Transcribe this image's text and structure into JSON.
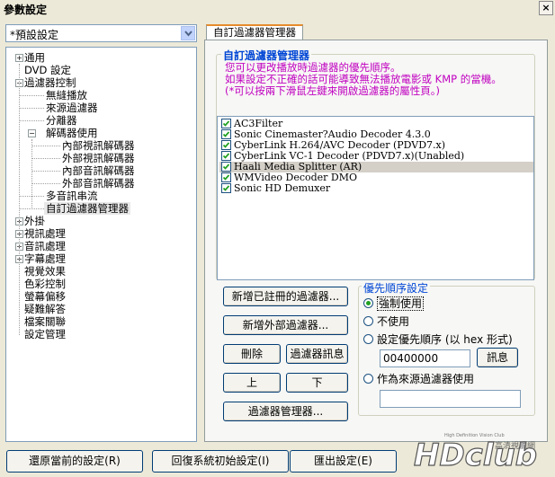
{
  "window": {
    "title": "參數設定",
    "close_label": "×"
  },
  "profile": {
    "selected": "*預設設定"
  },
  "tree": [
    {
      "label": "通用",
      "level": 0,
      "expander": "+"
    },
    {
      "label": "DVD 設定",
      "level": 0,
      "expander": ""
    },
    {
      "label": "過濾器控制",
      "level": 0,
      "expander": "-"
    },
    {
      "label": "無縫播放",
      "level": 1,
      "expander": ""
    },
    {
      "label": "來源過濾器",
      "level": 1,
      "expander": ""
    },
    {
      "label": "分離器",
      "level": 1,
      "expander": ""
    },
    {
      "label": "解碼器使用",
      "level": 1,
      "expander": "-"
    },
    {
      "label": "內部視訊解碼器",
      "level": 2,
      "expander": ""
    },
    {
      "label": "外部視訊解碼器",
      "level": 2,
      "expander": ""
    },
    {
      "label": "內部音訊解碼器",
      "level": 2,
      "expander": ""
    },
    {
      "label": "外部音訊解碼器",
      "level": 2,
      "expander": ""
    },
    {
      "label": "多音訊串流",
      "level": 1,
      "expander": ""
    },
    {
      "label": "自訂過濾器管理器",
      "level": 1,
      "expander": "",
      "selected": true
    },
    {
      "label": "外掛",
      "level": 0,
      "expander": "+"
    },
    {
      "label": "視訊處理",
      "level": 0,
      "expander": "+"
    },
    {
      "label": "音訊處理",
      "level": 0,
      "expander": "+"
    },
    {
      "label": "字幕處理",
      "level": 0,
      "expander": "+"
    },
    {
      "label": "視覺效果",
      "level": 0,
      "expander": ""
    },
    {
      "label": "色彩控制",
      "level": 0,
      "expander": ""
    },
    {
      "label": "螢幕偏移",
      "level": 0,
      "expander": ""
    },
    {
      "label": "疑難解答",
      "level": 0,
      "expander": ""
    },
    {
      "label": "檔案關聯",
      "level": 0,
      "expander": ""
    },
    {
      "label": "設定管理",
      "level": 0,
      "expander": ""
    }
  ],
  "tab": {
    "label": "自訂過濾器管理器"
  },
  "section": {
    "title": "自訂過濾器管理器",
    "notes": [
      "您可以更改播放時過濾器的優先順序。",
      "如果設定不正確的話可能導致無法播放電影或 KMP 的當機。",
      "(*可以按兩下滑鼠左鍵來開啟過濾器的屬性頁。)"
    ]
  },
  "filters": [
    {
      "name": "AC3Filter",
      "checked": true,
      "selected": false
    },
    {
      "name": "Sonic Cinemaster?Audio Decoder 4.3.0",
      "checked": true,
      "selected": false
    },
    {
      "name": "CyberLink H.264/AVC Decoder (PDVD7.x)",
      "checked": true,
      "selected": false
    },
    {
      "name": "CyberLink VC-1 Decoder (PDVD7.x)(Unabled)",
      "checked": true,
      "selected": false
    },
    {
      "name": "Haali Media Splitter (AR)",
      "checked": true,
      "selected": true
    },
    {
      "name": "WMVideo Decoder DMO",
      "checked": true,
      "selected": false
    },
    {
      "name": "Sonic HD Demuxer",
      "checked": true,
      "selected": false
    }
  ],
  "buttons": {
    "add_registered": "新增已註冊的過濾器...",
    "add_external": "新增外部過濾器...",
    "delete": "刪除",
    "filter_info": "過濾器訊息",
    "up": "上",
    "down": "下",
    "filter_manager": "過濾器管理器...",
    "info": "訊息"
  },
  "priority": {
    "title": "優先順序設定",
    "options": [
      {
        "label": "強制使用",
        "selected": true
      },
      {
        "label": "不使用",
        "selected": false
      },
      {
        "label": "設定優先順序 (以 hex 形式)",
        "selected": false
      },
      {
        "label": "作為來源過濾器使用",
        "selected": false
      }
    ],
    "hex_value": "00400000",
    "source_value": ""
  },
  "bottom_buttons": {
    "restore": "還原當前的設定(R)",
    "reset": "回復系統初始設定(I)",
    "export": "匯出設定(E)"
  },
  "watermark": {
    "brand": "HDclub",
    "tagline": "High Definition Vision Club",
    "chinese": "高清視聽網"
  }
}
